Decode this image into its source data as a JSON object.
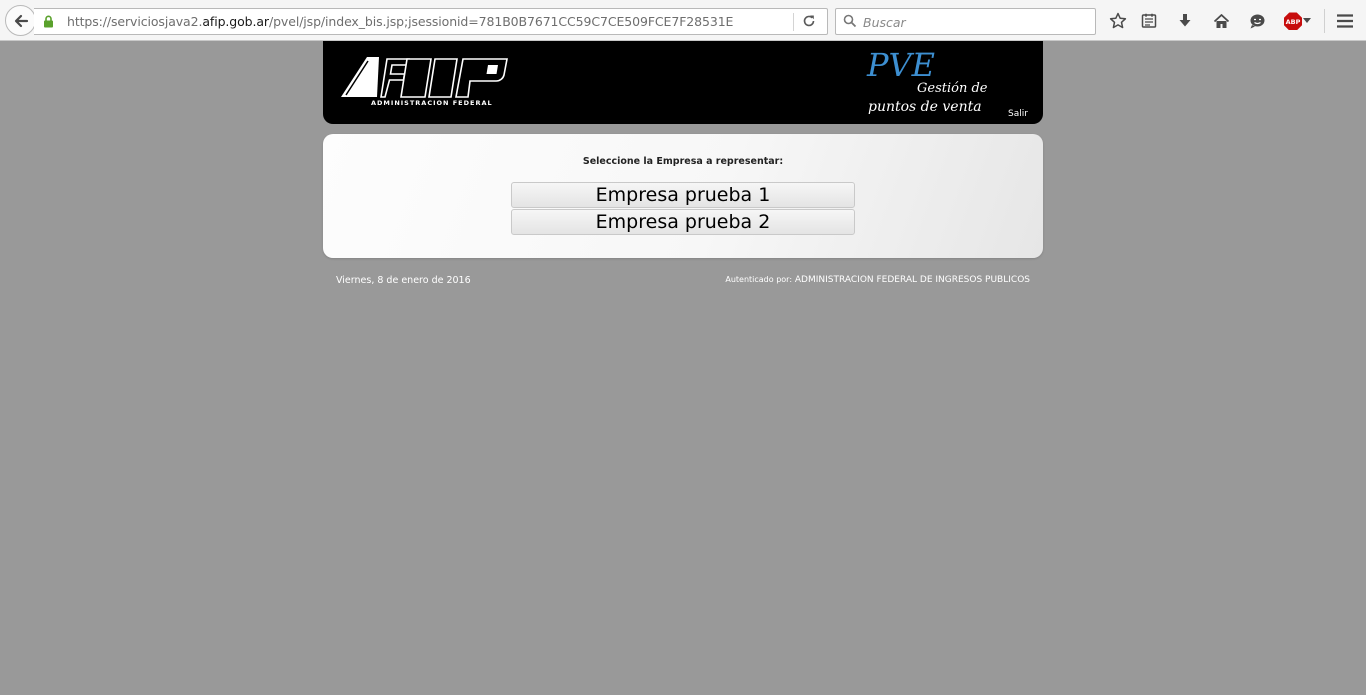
{
  "browser": {
    "url": {
      "prefix": "https://serviciosjava2.",
      "domain": "afip.gob.ar",
      "path": "/pvel/jsp/index_bis.jsp;jsessionid=781B0B7671CC59C7CE509FCE7F28531E"
    },
    "search_placeholder": "Buscar",
    "icons": [
      "back-icon",
      "lock-icon",
      "reload-icon",
      "search-icon",
      "bookmark-star-icon",
      "reading-list-icon",
      "download-icon",
      "home-icon",
      "chat-icon",
      "adblock-plus-icon",
      "menu-icon"
    ],
    "adblock_label": "ABP"
  },
  "header": {
    "logo_text": "AFIP",
    "logo_subtitle": "ADMINISTRACION FEDERAL",
    "app_name": "PVE",
    "app_subtitle_line1": "Gestión de",
    "app_subtitle_line2": "puntos de venta",
    "logout_label": "Salir"
  },
  "selection": {
    "title": "Seleccione la Empresa a representar:",
    "companies": [
      "Empresa prueba 1",
      "Empresa prueba 2"
    ]
  },
  "footer": {
    "date": "Viernes, 8 de enero de 2016",
    "auth_label": "Autenticado por:",
    "auth_entity": "ADMINISTRACION FEDERAL DE INGRESOS PUBLICOS"
  },
  "colors": {
    "page_background": "#999999",
    "header_background": "#000000",
    "pve_blue": "#3d8fd1",
    "lock_green": "#5aa12c",
    "adblock_red": "#c70d0d"
  }
}
